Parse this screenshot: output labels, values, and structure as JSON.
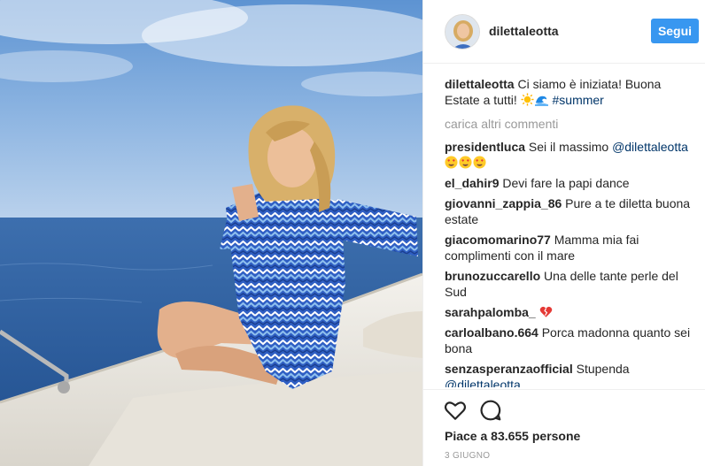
{
  "post": {
    "username": "dilettaleotta",
    "follow_label": "Segui",
    "caption": {
      "user": "dilettaleotta",
      "text": "Ci siamo è iniziata! Buona Estate a tutti!",
      "hashtag": "#summer",
      "emoji_icons": [
        "sun-emoji-icon",
        "wave-emoji-icon"
      ]
    },
    "load_more_label": "carica altri commenti",
    "comments": [
      {
        "user": "presidentluca",
        "text": "Sei il massimo",
        "mention": "@dilettaleotta",
        "emoji_icons": [
          "heart-eyes-face-icon",
          "heart-eyes-face-icon",
          "heart-eyes-face-icon"
        ]
      },
      {
        "user": "el_dahir9",
        "text": "Devi fare la papi dance"
      },
      {
        "user": "giovanni_zappia_86",
        "text": "Pure a te diletta buona estate"
      },
      {
        "user": "giacomomarino77",
        "text": "Mamma mia fai complimenti con il mare"
      },
      {
        "user": "brunozuccarello",
        "text": "Una delle tante perle del Sud"
      },
      {
        "user": "sarahpalomba_",
        "text": "",
        "emoji_icons": [
          "broken-heart-icon"
        ]
      },
      {
        "user": "carloalbano.664",
        "text": "Porca madonna quanto sei bona"
      },
      {
        "user": "senzasperanzaofficial",
        "text": "Stupenda",
        "mention": "@dilettaleotta"
      }
    ],
    "likes_label": "Piace a 83.655 persone",
    "date_label": "3 GIUGNO",
    "colors": {
      "follow_button": "#3897f0",
      "link": "#003569",
      "muted": "#999999"
    }
  }
}
